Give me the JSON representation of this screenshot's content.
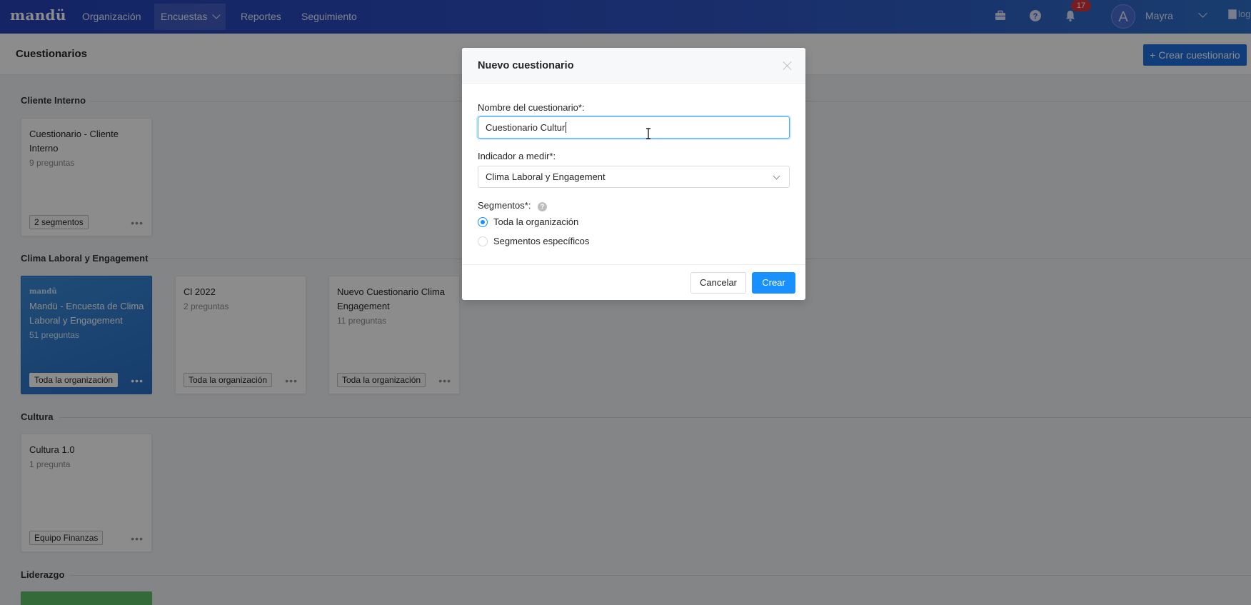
{
  "nav": {
    "logo": "mandü",
    "items": [
      {
        "label": "Organización"
      },
      {
        "label": "Encuestas"
      },
      {
        "label": "Reportes"
      },
      {
        "label": "Seguimiento"
      }
    ],
    "notification_count": "17",
    "avatar_letter": "A",
    "user_name": "Mayra",
    "logo_alt": "logo"
  },
  "page": {
    "title": "Cuestionarios",
    "create_button": "+ Crear cuestionario"
  },
  "sections": [
    {
      "title": "Cliente Interno",
      "cards": [
        {
          "title": "Cuestionario - Cliente Interno",
          "subtitle": "9 preguntas",
          "tag": "2 segmentos"
        }
      ]
    },
    {
      "title": "Clima Laboral y Engagement",
      "cards": [
        {
          "brand": "mandü",
          "title": "Mandü - Encuesta de Clima Laboral y Engagement",
          "subtitle": "51 preguntas",
          "tag": "Toda la organización"
        },
        {
          "title": "Cl 2022",
          "subtitle": "2 preguntas",
          "tag": "Toda la organización"
        },
        {
          "title": "Nuevo Cuestionario Clima Engagement",
          "subtitle": "11 preguntas",
          "tag": "Toda la organización"
        }
      ]
    },
    {
      "title": "Cultura",
      "cards": [
        {
          "title": "Cultura 1.0",
          "subtitle": "1 pregunta",
          "tag": "Equipo Finanzas"
        }
      ]
    },
    {
      "title": "Liderazgo",
      "cards": []
    }
  ],
  "modal": {
    "title": "Nuevo cuestionario",
    "name_label": "Nombre del cuestionario*:",
    "name_value": "Cuestionario Cultur",
    "indicator_label": "Indicador a medir*:",
    "indicator_value": "Clima Laboral y Engagement",
    "segments_label": "Segmentos*:",
    "segment_options": [
      {
        "label": "Toda la organización",
        "checked": true
      },
      {
        "label": "Segmentos específicos",
        "checked": false
      }
    ],
    "cancel_label": "Cancelar",
    "create_label": "Crear"
  },
  "colors": {
    "nav_gradient_start": "#2542b8",
    "nav_gradient_end": "#2f6fc8",
    "primary": "#1890ff",
    "badge": "#d9363e"
  }
}
